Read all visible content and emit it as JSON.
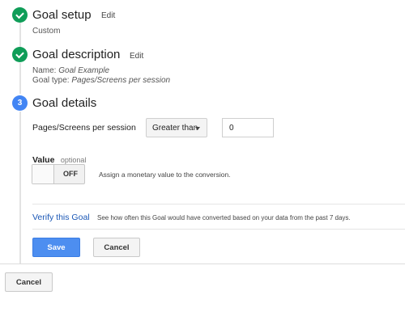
{
  "steps": [
    {
      "title": "Goal setup",
      "edit_label": "Edit",
      "summary": "Custom",
      "status": "complete",
      "icon": "check-icon"
    },
    {
      "title": "Goal description",
      "edit_label": "Edit",
      "name_label": "Name:",
      "name_value": "Goal Example",
      "type_label": "Goal type:",
      "type_value": "Pages/Screens per session",
      "status": "complete",
      "icon": "check-icon"
    },
    {
      "number": "3",
      "title": "Goal details",
      "status": "current"
    }
  ],
  "details": {
    "condition_label": "Pages/Screens per session",
    "comparison_selected": "Greater than",
    "comparison_value": "0",
    "value_label": "Value",
    "value_optional": "optional",
    "toggle_state": "OFF",
    "toggle_description": "Assign a monetary value to the conversion."
  },
  "verify": {
    "link_label": "Verify this Goal",
    "description": "See how often this Goal would have converted based on your data from the past 7 days."
  },
  "buttons": {
    "save": "Save",
    "cancel": "Cancel",
    "bottom_cancel": "Cancel"
  },
  "colors": {
    "complete": "#0f9d58",
    "current": "#4285f4",
    "primary_button": "#4d8ef0",
    "link": "#1a57b6"
  }
}
